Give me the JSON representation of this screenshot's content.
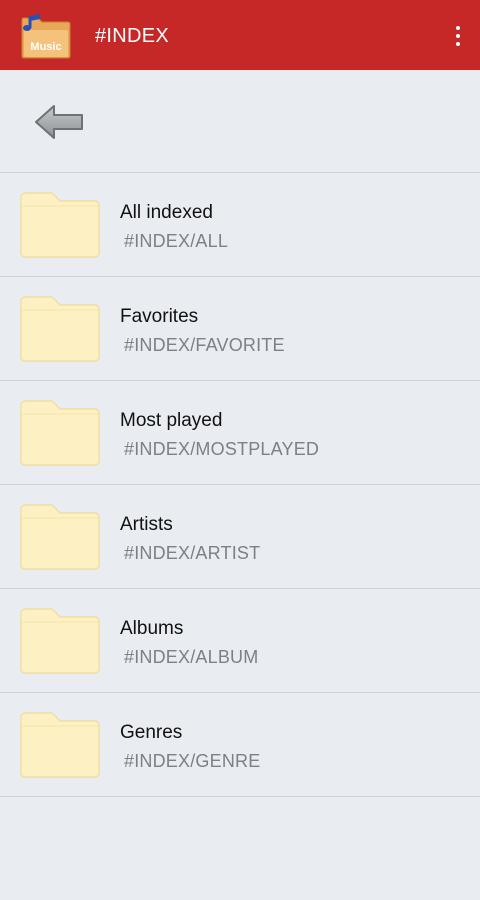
{
  "app_bar": {
    "title": "#INDEX",
    "logo_text": "Music",
    "logo_icon": "music-folder-logo",
    "menu_icon": "more-vert-icon",
    "background_color": "#c62828"
  },
  "navigation": {
    "back_icon": "back-arrow-icon"
  },
  "folders": [
    {
      "label": "All indexed",
      "path": "#INDEX/ALL"
    },
    {
      "label": "Favorites",
      "path": "#INDEX/FAVORITE"
    },
    {
      "label": "Most played",
      "path": "#INDEX/MOSTPLAYED"
    },
    {
      "label": "Artists",
      "path": "#INDEX/ARTIST"
    },
    {
      "label": "Albums",
      "path": "#INDEX/ALBUM"
    },
    {
      "label": "Genres",
      "path": "#INDEX/GENRE"
    }
  ],
  "colors": {
    "folder_fill": "#fdf1c4",
    "folder_stroke": "#f0dfa0",
    "background": "#e9edf2"
  }
}
